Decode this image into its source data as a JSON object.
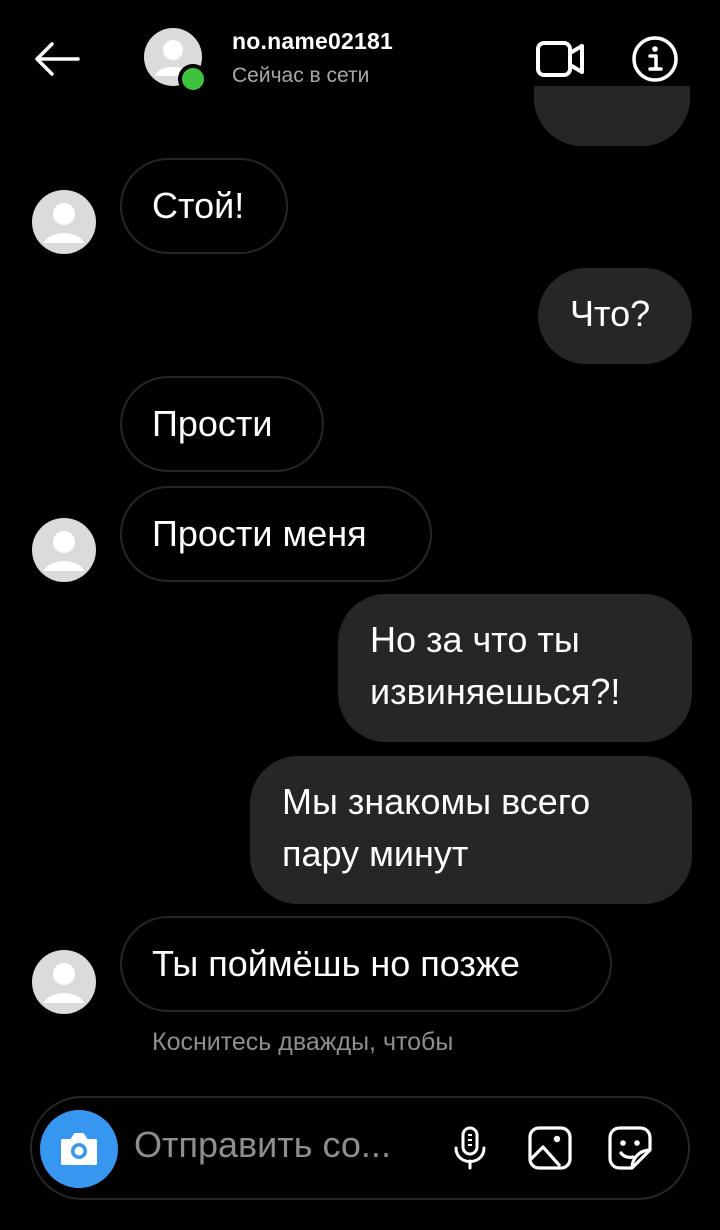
{
  "header": {
    "username": "no.name02181",
    "status": "Сейчас в сети",
    "online_color": "#3ec33f",
    "icons": {
      "back": "arrow-left-icon",
      "video": "video-camera-icon",
      "info": "info-icon"
    }
  },
  "messages": [
    {
      "direction": "incoming",
      "text": "Стой!",
      "avatar": true
    },
    {
      "direction": "outgoing",
      "text": "Что?"
    },
    {
      "direction": "incoming",
      "text": "Прости",
      "avatar": false
    },
    {
      "direction": "incoming",
      "text": "Прости меня",
      "avatar": true
    },
    {
      "direction": "outgoing",
      "lines": [
        "Но за что ты",
        "извиняешься?!"
      ]
    },
    {
      "direction": "outgoing",
      "lines": [
        "Мы знакомы всего",
        "пару минут"
      ]
    },
    {
      "direction": "incoming",
      "text": "Ты поймёшь но позже",
      "avatar": true
    }
  ],
  "hint": "Коснитесь дважды, чтобы",
  "composer": {
    "placeholder": "Отправить со...",
    "accent_color": "#3797f0",
    "icons": [
      "camera-icon",
      "microphone-icon",
      "gallery-icon",
      "sticker-icon"
    ]
  }
}
